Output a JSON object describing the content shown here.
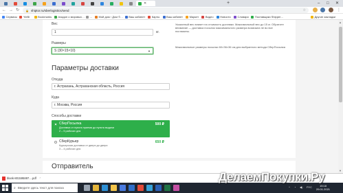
{
  "browser": {
    "tabs": [
      {
        "icon": "vk-icon",
        "color": "#4a76a8"
      },
      {
        "icon": "ru-icon",
        "color": "#e34b3a"
      },
      {
        "icon": "mail-icon",
        "color": "#168de2"
      },
      {
        "icon": "green-icon",
        "color": "#3ea64a"
      },
      {
        "icon": "orange-icon",
        "color": "#f6a21d"
      },
      {
        "icon": "blue-icon",
        "color": "#3b6fd1"
      },
      {
        "icon": "purple-icon",
        "color": "#7c4dcc"
      },
      {
        "icon": "teal-icon",
        "color": "#20a39e"
      },
      {
        "icon": "red-icon",
        "color": "#d64541"
      },
      {
        "icon": "dark-icon",
        "color": "#444444"
      },
      {
        "icon": "blue2-icon",
        "color": "#2e86de"
      },
      {
        "icon": "green2-icon",
        "color": "#27ae60"
      },
      {
        "icon": "yellow-icon",
        "color": "#f1c40f"
      },
      {
        "icon": "gray-icon",
        "color": "#888888"
      },
      {
        "icon": "sberlogistics-icon",
        "color": "#2eaf4a",
        "active": true
      }
    ],
    "new_tab": "+",
    "window_controls": {
      "minimize": "–",
      "maximize": "□",
      "close": "✕"
    },
    "close_tab": "✕",
    "url": "shiptor.ru/sberlogistics/send",
    "bookmarks": [
      {
        "label": "Сервисы",
        "color": "#4285f4"
      },
      {
        "label": "YieBi",
        "color": "#e34b3a"
      },
      {
        "label": "Bookmarks",
        "color": "#f0b400"
      },
      {
        "label": "Ахадон о мировых…",
        "color": "#3ea64a"
      },
      {
        "label": "…",
        "color": "#999999"
      },
      {
        "label": "Мой дом › Дом ©…",
        "color": "#e67e22"
      },
      {
        "label": "Ваш кабинет",
        "color": "#3b6fd1"
      },
      {
        "label": "Карты",
        "color": "#e34b3a"
      },
      {
        "label": "Ваш кабинет",
        "color": "#3b6fd1"
      },
      {
        "label": "Маркет",
        "color": "#f6a21d"
      },
      {
        "label": "Видео",
        "color": "#d64541"
      },
      {
        "label": "Новости",
        "color": "#2e86de"
      },
      {
        "label": "Словари",
        "color": "#7c4dcc"
      },
      {
        "label": "Поставщики Shipper…",
        "color": "#2eaf4a"
      },
      {
        "label": "Другие закладки",
        "color": "#f0b400"
      }
    ]
  },
  "page": {
    "weight_label": "Вес",
    "weight_value": "1",
    "weight_unit": "кг.",
    "weight_note": "Указанный вес влияет на стоимость доставки. Максимальный вес до 15 кг. Обратите внимание — доставка посылок максимального размера возможна не во все постаматы.",
    "size_label": "Размеры",
    "size_value": "S (30×15×10)",
    "size_note": "Максимальные размеры посылки 60×36×36 см для выбранного метода СберПосылка",
    "delivery_heading": "Параметры доставки",
    "from_label": "Откуда",
    "from_value": "г. Астрахань, Астраханская область, Россия",
    "to_label": "Куда",
    "to_value": "г. Москва, Россия",
    "methods_label": "Способы доставки",
    "methods": [
      {
        "title": "СберПосылка",
        "desc1": "Доставка от пункта приема до пункта выдачи",
        "desc2": "2 – 5 рабочих дня",
        "price": "500 ₽",
        "selected": true
      },
      {
        "title": "СберКурьер",
        "desc1": "Курьерская доставка от двери до двери",
        "desc2": "3 – 4 рабочих дня",
        "price": "650 ₽",
        "selected": false
      }
    ],
    "sender_heading": "Отправитель"
  },
  "downloads": {
    "file": "blank-801595897....pdf"
  },
  "taskbar": {
    "search_placeholder": "Введите здесь текст для поиска",
    "tray_lang": "РУС",
    "time": "15:18",
    "date": "29.01.2021",
    "icons": [
      {
        "name": "task-view-icon",
        "color": "#9aa4b1"
      },
      {
        "name": "chrome-icon",
        "color": "#e3b43b"
      },
      {
        "name": "edge-icon",
        "color": "#2d8fd5"
      },
      {
        "name": "explorer-icon",
        "color": "#f3c44a"
      },
      {
        "name": "store-icon",
        "color": "#4a7be0"
      },
      {
        "name": "mail-app-icon",
        "color": "#2f6ec8"
      },
      {
        "name": "yandex-icon",
        "color": "#e34b3a"
      },
      {
        "name": "telegram-icon",
        "color": "#37a2d9"
      },
      {
        "name": "word-icon",
        "color": "#2b5fb4"
      },
      {
        "name": "excel-icon",
        "color": "#207245"
      },
      {
        "name": "photo-icon",
        "color": "#c44fa3"
      }
    ]
  },
  "watermark": "ДелаемПокупки.Ру"
}
